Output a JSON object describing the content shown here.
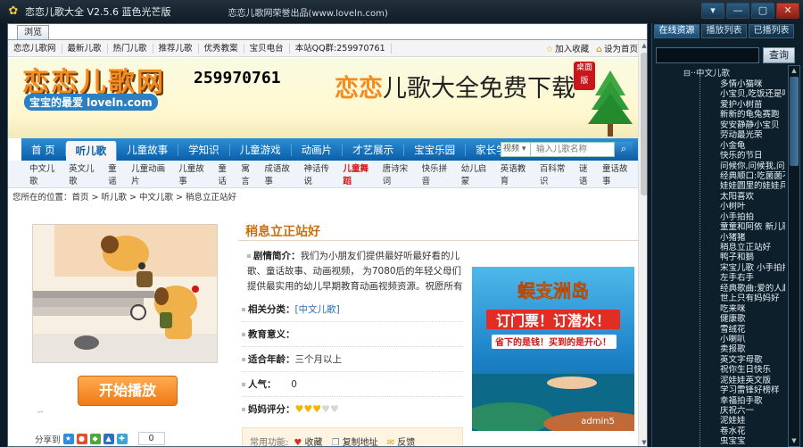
{
  "window": {
    "title": "恋恋儿歌大全 V2.5.6 蓝色光芒版",
    "copyright": "恋恋儿歌网荣誉出品(www.loveln.com)",
    "buttons": [
      "▾",
      "—",
      "▢",
      "✕"
    ]
  },
  "browser_tab": "浏览",
  "top_nav": {
    "items": [
      "恋恋儿歌网",
      "最新儿歌",
      "热门儿歌",
      "推荐儿歌",
      "优秀教案",
      "宝贝电台",
      "本站QQ群:259970761"
    ],
    "bookmark": "加入收藏",
    "homepage": "设为首页"
  },
  "banner": {
    "logo": "恋恋儿歌网",
    "logo_sub": "宝宝的最爱 loveln.com",
    "tel": "259970761",
    "slogan": "恋恋儿歌大全免费下载",
    "slogan_first": "恋恋",
    "slogan_rest": "儿歌大全免费下载",
    "badge": "桌面版"
  },
  "main_nav": {
    "items": [
      "首 页",
      "听儿歌",
      "儿童故事",
      "学知识",
      "儿童游戏",
      "动画片",
      "才艺展示",
      "宝宝乐园",
      "家长学堂"
    ],
    "search_select": "视频",
    "search_placeholder": "输入儿歌名称"
  },
  "sub_nav": [
    "中文儿歌",
    "英文儿歌",
    "童谣",
    "儿童动画片",
    "儿童故事",
    "童话",
    "寓言",
    "成语故事",
    "神话传说",
    "儿童舞蹈",
    "唐诗宋词",
    "快乐拼音",
    "幼儿启蒙",
    "英语教育",
    "百科常识",
    "谜语",
    "童话故事"
  ],
  "breadcrumb": "您所在的位置：首页 > 听儿歌 > 中文儿歌 > 稍息立正站好",
  "player": {
    "start_label": "开始播放",
    "dash": "--",
    "share_label": "分享到",
    "share_count": "0"
  },
  "song": {
    "title": "稍息立正站好",
    "intro_label": "剧情简介：",
    "intro_text": "我们为小朋友们提供最好听最好看的儿歌、童话故事、动画视频， 为7080后的年轻父母们提供最实用的幼儿早期教育动画视频资源。祝愿所有的小",
    "category_label": "相关分类：",
    "category_value": "[中文儿歌]",
    "edu_label": "教育意义：",
    "age_label": "适合年龄：",
    "age_value": "三个月以上",
    "pop_label": "人气：",
    "pop_value": "0",
    "rating_label": "妈妈评分：",
    "rating": 3,
    "rating_max": 5,
    "func_label": "常用功能:",
    "fav": "收藏",
    "copy": "复制地址",
    "feedback": "反馈"
  },
  "ad": {
    "title": "蜈支洲岛",
    "line1": "订门票！订潜水！",
    "line2": "省下的是钱！买到的是开心！",
    "watermark": "admin5"
  },
  "right": {
    "tabs": [
      "在线资源",
      "播放列表",
      "已播列表"
    ],
    "search_button": "查询",
    "root": "中文儿歌",
    "items": [
      "多情小猫咪",
      "小宝贝,吃饭还是喝",
      "爱护小树苗",
      "新新的龟兔赛跑",
      "安安静静小宝贝",
      "劳动最光荣",
      "小金龟",
      "快乐的节日",
      "问候你,问候我,问候",
      "经典顺口:吃菌菌不",
      "娃娃圆里的娃娃兵",
      "太阳喜欢",
      "小树叶",
      "小手拍拍",
      "童童和阿依 新儿歌",
      "小猪猪",
      "稍息立正站好",
      "鸭子和鹅",
      "宋宝儿歌 小手拍拍",
      "左手右手",
      "经典歌曲:爱的人越",
      "世上只有妈妈好",
      "吃来咪",
      "健康歌",
      "雪绒花",
      "小喇叭",
      "卖报歌",
      "英文字母歌",
      "祝你生日快乐",
      "泥娃娃英文版",
      "学习雷锋好榜样",
      "幸福拍手歌",
      "庆祝六一",
      "泥娃娃",
      "卷水花",
      "虫宝宝"
    ]
  }
}
